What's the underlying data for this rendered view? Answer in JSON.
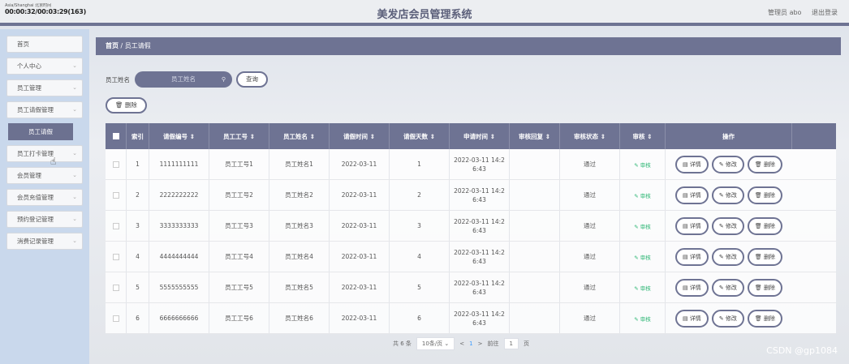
{
  "header": {
    "clock_line1": "Asia/Shanghai 北京时间",
    "clock_line2": "00:00:32/00:03:29(163)",
    "title": "美发店会员管理系统",
    "user": "管理员 abo",
    "logout": "退出登录"
  },
  "sidebar": {
    "items": [
      {
        "label": "首页",
        "chev": ""
      },
      {
        "label": "个人中心",
        "chev": "⌄"
      },
      {
        "label": "员工管理",
        "chev": "⌄"
      },
      {
        "label": "员工请假管理",
        "chev": "⌄"
      },
      {
        "label": "员工请假",
        "sub": true
      },
      {
        "label": "员工打卡管理",
        "chev": "⌄"
      },
      {
        "label": "会员管理",
        "chev": "⌄"
      },
      {
        "label": "会员充值管理",
        "chev": "⌄"
      },
      {
        "label": "预约登记管理",
        "chev": "⌄"
      },
      {
        "label": "消费记录管理",
        "chev": "⌄"
      }
    ]
  },
  "breadcrumb": {
    "home": "首页",
    "sep": "/",
    "current": "员工请假"
  },
  "search": {
    "label": "员工姓名",
    "placeholder": "员工姓名",
    "button": "查询"
  },
  "delete_button": "删除",
  "table": {
    "headers": [
      "",
      "索引",
      "请假编号 ⇕",
      "员工工号 ⇕",
      "员工姓名 ⇕",
      "请假时间 ⇕",
      "请假天数 ⇕",
      "申请时间 ⇕",
      "审核回复 ⇕",
      "审核状态 ⇕",
      "审核 ⇕",
      "操作"
    ],
    "rows": [
      {
        "idx": "1",
        "no": "1111111111",
        "emp_id": "员工工号1",
        "name": "员工姓名1",
        "date": "2022-03-11",
        "days": "1",
        "apply1": "2022-03-11 14:2",
        "apply2": "6:43",
        "reply": "",
        "status": "通过",
        "audit": "审核"
      },
      {
        "idx": "2",
        "no": "2222222222",
        "emp_id": "员工工号2",
        "name": "员工姓名2",
        "date": "2022-03-11",
        "days": "2",
        "apply1": "2022-03-11 14:2",
        "apply2": "6:43",
        "reply": "",
        "status": "通过",
        "audit": "审核"
      },
      {
        "idx": "3",
        "no": "3333333333",
        "emp_id": "员工工号3",
        "name": "员工姓名3",
        "date": "2022-03-11",
        "days": "3",
        "apply1": "2022-03-11 14:2",
        "apply2": "6:43",
        "reply": "",
        "status": "通过",
        "audit": "审核"
      },
      {
        "idx": "4",
        "no": "4444444444",
        "emp_id": "员工工号4",
        "name": "员工姓名4",
        "date": "2022-03-11",
        "days": "4",
        "apply1": "2022-03-11 14:2",
        "apply2": "6:43",
        "reply": "",
        "status": "通过",
        "audit": "审核"
      },
      {
        "idx": "5",
        "no": "5555555555",
        "emp_id": "员工工号5",
        "name": "员工姓名5",
        "date": "2022-03-11",
        "days": "5",
        "apply1": "2022-03-11 14:2",
        "apply2": "6:43",
        "reply": "",
        "status": "通过",
        "audit": "审核"
      },
      {
        "idx": "6",
        "no": "6666666666",
        "emp_id": "员工工号6",
        "name": "员工姓名6",
        "date": "2022-03-11",
        "days": "6",
        "apply1": "2022-03-11 14:2",
        "apply2": "6:43",
        "reply": "",
        "status": "通过",
        "audit": "审核"
      }
    ],
    "ops": {
      "detail": "详情",
      "edit": "修改",
      "delete": "删除"
    }
  },
  "pager": {
    "total": "共 6 条",
    "size": "10条/页 ⌄",
    "prev": "<",
    "page": "1",
    "next": ">",
    "goto": "前往",
    "goto_value": "1",
    "page_unit": "页"
  },
  "watermark": "CSDN @gp1084"
}
